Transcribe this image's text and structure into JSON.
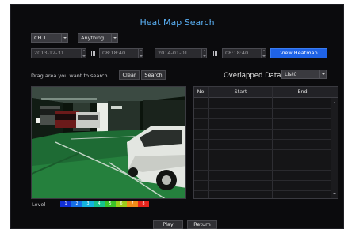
{
  "title": "Heat Map Search",
  "filters": {
    "channel": "CH 1",
    "event": "Anything"
  },
  "start": {
    "date": "2013-12-31",
    "time": "08:18:40"
  },
  "end": {
    "date": "2014-01-01",
    "time": "08:18:40"
  },
  "view_heatmap_label": "View Heatmap",
  "drag_hint": "Drag area you want to search.",
  "clear_label": "Clear",
  "search_label": "Search",
  "overlapped_label": "Overlapped Data",
  "list_select": "List0",
  "table": {
    "columns": [
      "No.",
      "Start",
      "End"
    ],
    "rows": []
  },
  "level_label": "Level",
  "level_scale": [
    {
      "n": "1",
      "color": "#1230d6"
    },
    {
      "n": "2",
      "color": "#1670e6"
    },
    {
      "n": "3",
      "color": "#14b3de"
    },
    {
      "n": "4",
      "color": "#17c28c"
    },
    {
      "n": "5",
      "color": "#3bc227"
    },
    {
      "n": "6",
      "color": "#9ccd1a"
    },
    {
      "n": "7",
      "color": "#f08c18"
    },
    {
      "n": "8",
      "color": "#e6241c"
    }
  ],
  "play_label": "Play",
  "return_label": "Return",
  "colors": {
    "accent": "#1f63e6",
    "title": "#5ab0f4"
  }
}
